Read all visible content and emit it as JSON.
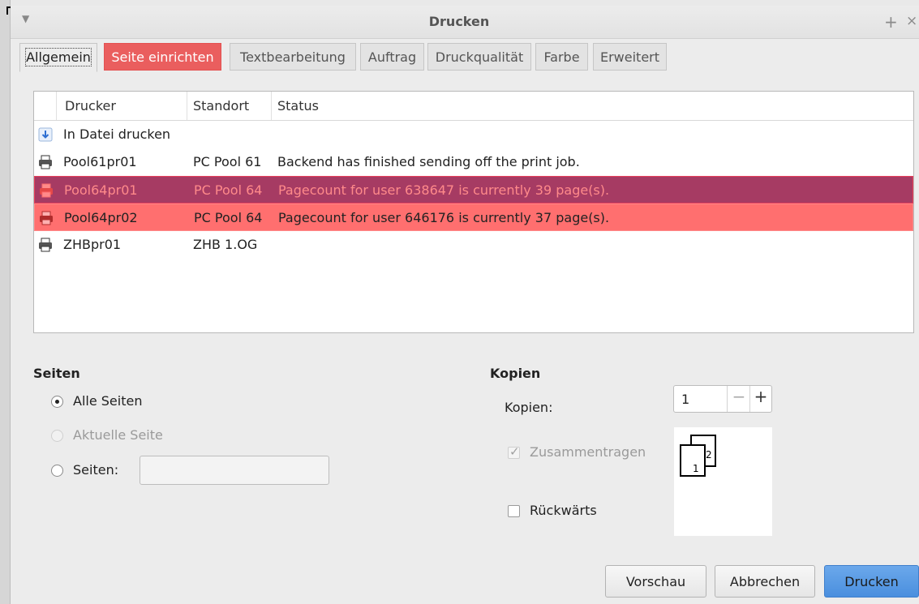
{
  "window": {
    "title": "Drucken",
    "menu_icon": "chevron-down-icon",
    "plus_icon": "plus-icon",
    "close_icon": "close-icon"
  },
  "tabs": [
    {
      "label": "Allgemein"
    },
    {
      "label": "Seite einrichten"
    },
    {
      "label": "Textbearbeitung"
    },
    {
      "label": "Auftrag"
    },
    {
      "label": "Druckqualität"
    },
    {
      "label": "Farbe"
    },
    {
      "label": "Erweitert"
    }
  ],
  "printers": {
    "columns": [
      "Drucker",
      "Standort",
      "Status"
    ],
    "rows": [
      {
        "icon": "download-icon",
        "name": "In Datei drucken",
        "location": "",
        "status": ""
      },
      {
        "icon": "printer-icon",
        "name": "Pool61pr01",
        "location": "PC Pool 61",
        "status": "Backend has finished sending off the print job."
      },
      {
        "icon": "printer-icon",
        "name": "Pool64pr01",
        "location": "PC Pool 64",
        "status": "Pagecount for user 638647 is currently 39 page(s)."
      },
      {
        "icon": "printer-icon",
        "name": "Pool64pr02",
        "location": "PC Pool 64",
        "status": "Pagecount for user 646176 is currently 37 page(s)."
      },
      {
        "icon": "printer-icon",
        "name": "ZHBpr01",
        "location": "ZHB 1.OG",
        "status": ""
      }
    ]
  },
  "pages": {
    "heading": "Seiten",
    "all_pages": "Alle Seiten",
    "current_page": "Aktuelle Seite",
    "pages_label": "Seiten:",
    "pages_value": ""
  },
  "copies": {
    "heading": "Kopien",
    "label": "Kopien:",
    "value": "1",
    "minus": "−",
    "plus": "+",
    "collate": "Zusammentragen",
    "reverse": "Rückwärts",
    "preview_page1": "1",
    "preview_page2": "2"
  },
  "buttons": {
    "preview": "Vorschau",
    "cancel": "Abbrechen",
    "print": "Drucken"
  },
  "colors": {
    "accent_blue": "#4a8fde",
    "highlight_red": "#ff6f6f",
    "selection_dark": "#a63b63"
  }
}
